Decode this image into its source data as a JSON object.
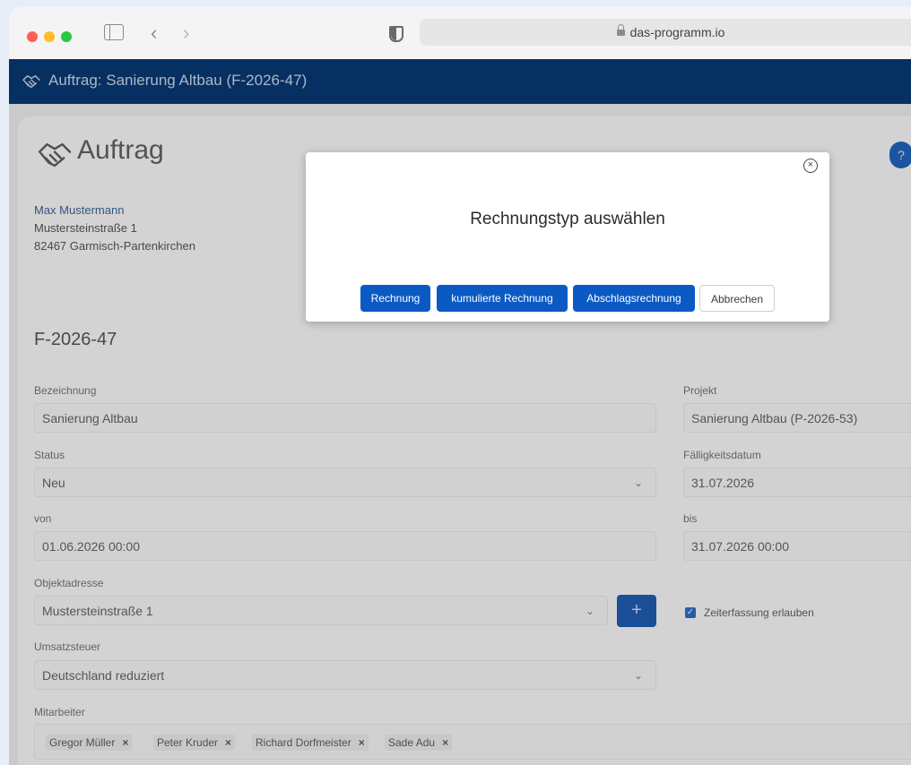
{
  "browser": {
    "url": "das-programm.io"
  },
  "app_header": {
    "title": "Auftrag: Sanierung Altbau (F-2026-47)"
  },
  "page": {
    "title": "Auftrag",
    "help_label": "?",
    "customer": {
      "name": "Max Mustermann",
      "street": "Mustersteinstraße 1",
      "city": "82467 Garmisch-Partenkirchen"
    },
    "order_number": "F-2026-47"
  },
  "form": {
    "bezeichnung": {
      "label": "Bezeichnung",
      "value": "Sanierung Altbau"
    },
    "projekt": {
      "label": "Projekt",
      "value": "Sanierung Altbau (P-2026-53)"
    },
    "status": {
      "label": "Status",
      "value": "Neu"
    },
    "faelligkeit": {
      "label": "Fälligkeitsdatum",
      "value": "31.07.2026"
    },
    "von": {
      "label": "von",
      "value": "01.06.2026 00:00"
    },
    "bis": {
      "label": "bis",
      "value": "31.07.2026 00:00"
    },
    "objektadresse": {
      "label": "Objektadresse",
      "value": "Mustersteinstraße 1",
      "add_label": "+"
    },
    "zeiterfassung": {
      "label": "Zeiterfassung erlauben",
      "checked": true
    },
    "umsatzsteuer": {
      "label": "Umsatzsteuer",
      "value": "Deutschland reduziert"
    },
    "mitarbeiter": {
      "label": "Mitarbeiter",
      "tags": [
        "Gregor Müller",
        "Peter Kruder",
        "Richard Dorfmeister",
        "Sade Adu"
      ],
      "remove_glyph": "×"
    }
  },
  "modal": {
    "title": "Rechnungstyp auswählen",
    "close_glyph": "×",
    "buttons": {
      "rechnung": "Rechnung",
      "kumuliert": "kumulierte Rechnung",
      "abschlag": "Abschlagsrechnung",
      "abbrechen": "Abbrechen"
    }
  },
  "colors": {
    "header_bg": "#08346a",
    "primary": "#0b5ac4"
  }
}
